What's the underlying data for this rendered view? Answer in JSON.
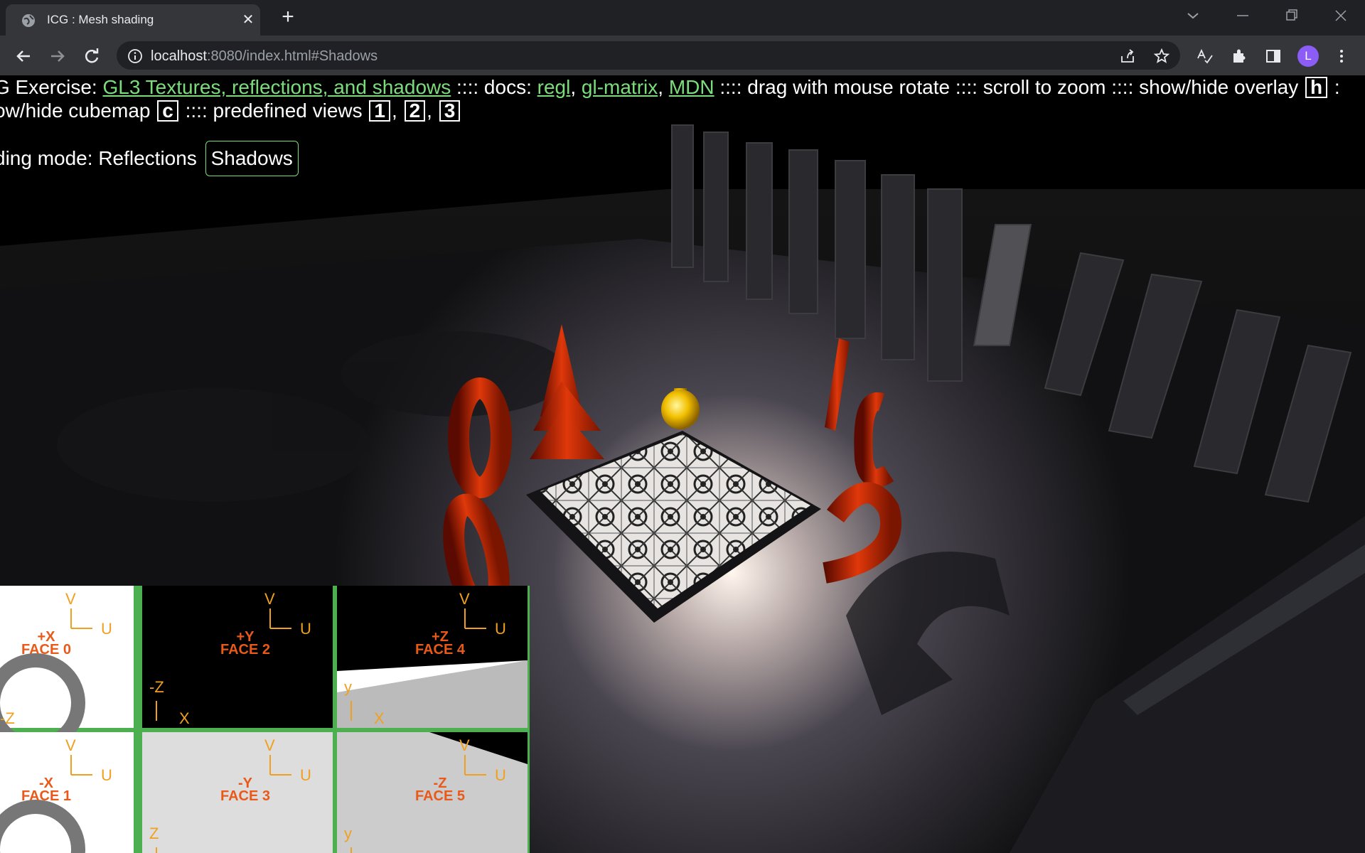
{
  "browser": {
    "tab_title": "ICG : Mesh shading",
    "url_host": "localhost",
    "url_path": ":8080/index.html#Shadows",
    "profile_initial": "L"
  },
  "overlay": {
    "line1_prefix": "G Exercise: ",
    "exercise_link": "GL3 Textures, reflections, and shadows",
    "docs_sep": " :::: docs: ",
    "doc_links": [
      "regl",
      "gl-matrix",
      "MDN"
    ],
    "line1_suffix": " :::: drag with mouse rotate :::: scroll to zoom :::: show/hide overlay ",
    "key_h": "h",
    "line1_tail": " :",
    "line2_prefix": "ow/hide cubemap ",
    "key_c": "c",
    "line2_mid": " :::: predefined views ",
    "views": [
      "1",
      "2",
      "3"
    ],
    "mode_label": "ding mode: Reflections",
    "mode_active": "Shadows"
  },
  "cubemap": {
    "faces": [
      {
        "axis": "+X",
        "name": "FACE 0",
        "u": "U",
        "v": "V",
        "extra": "-Z"
      },
      {
        "axis": "+Y",
        "name": "FACE 2",
        "u": "U",
        "v": "V",
        "b_v": "-Z",
        "b_u": "X"
      },
      {
        "axis": "+Z",
        "name": "FACE 4",
        "u": "U",
        "v": "V",
        "b_v": "y",
        "b_u": "X"
      },
      {
        "axis": "-X",
        "name": "FACE 1",
        "u": "U",
        "v": "V"
      },
      {
        "axis": "-Y",
        "name": "FACE 3",
        "u": "U",
        "v": "V",
        "b_v": "Z"
      },
      {
        "axis": "-Z",
        "name": "FACE 5",
        "u": "U",
        "v": "V",
        "b_v": "y"
      }
    ],
    "label_color": "#e8591a",
    "arrow_color": "#f0a020"
  }
}
